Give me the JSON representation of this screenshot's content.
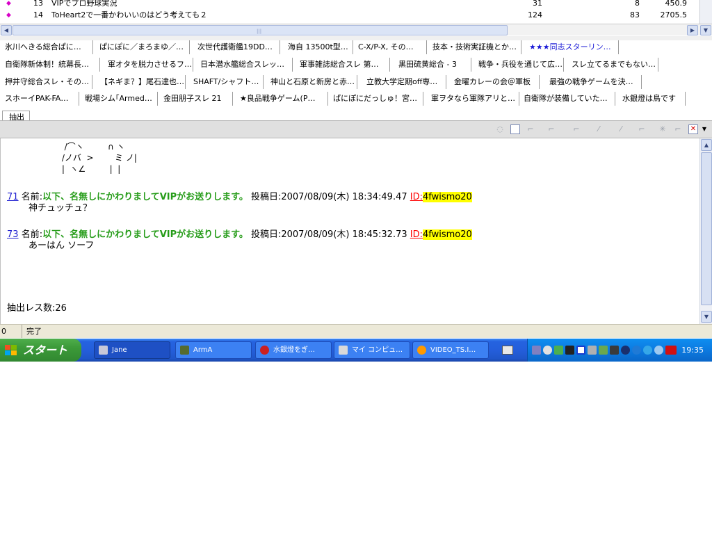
{
  "thread_list": {
    "rows": [
      {
        "mark": "◆",
        "num": "13",
        "title": "VIPでプロ野球実況",
        "res": "31",
        "new": "8",
        "speed": "450.9"
      },
      {
        "mark": "◆",
        "num": "14",
        "title": "ToHeart2で一番かわいいのはどう考えても２",
        "res": "124",
        "new": "83",
        "speed": "2705.5"
      }
    ]
  },
  "tabs": {
    "row1": [
      "氷川へきる総合ぱに…",
      "ぱにぽに／まろまゆ／…",
      "次世代護衛艦19DD…",
      "海自 13500t型…",
      "C-X/P-X, その…",
      "技本・技術実証機とか…",
      "★★★同志スターリン…"
    ],
    "row2": [
      "自衛隊新体制！統幕長…",
      "軍オタを脱力させるフ…",
      "日本潜水艦総合スレッ…",
      "軍事雑誌総合スレ 第…",
      "黒田硫黄総合 - 3",
      "戦争・兵役を通じて広…",
      "スレ立てるまでもない…"
    ],
    "row3": [
      "押井守総合スレ・その…",
      "【ネギま？】尾石達也…",
      "SHAFT/シャフト…",
      "神山と石原と新房と赤…",
      "立教大学定期off専…",
      "金曜カレーの会＠軍板",
      "最強の戦争ゲームを決…"
    ],
    "row4": [
      "スホーイPAK-FA…",
      "戦場シム｢Armed…",
      "金田朋子スレ 21",
      "★良品戦争ゲーム(P…",
      "ぱにぽにだっしゅ！宮…",
      "軍ヲタなら軍隊アリと…",
      "自衛隊が装備していた…",
      "水銀燈は鳥です"
    ],
    "extract": "抽出"
  },
  "viewer": {
    "aa": [
      "  /⌒ヽ         ∩ ヽ",
      " /ノバ  >        ミ ノ|",
      " |  ヽ∠         |  |"
    ],
    "posts": [
      {
        "num": "71",
        "name_label": "名前:",
        "name": "以下、名無しにかわりましてVIPがお送りします。",
        "date_label": "投稿日:",
        "date": "2007/08/09(木) 18:34:49.47",
        "id_label": "ID:",
        "id": "4fwismo20",
        "body": "神チュッチュ？"
      },
      {
        "num": "73",
        "name_label": "名前:",
        "name": "以下、名無しにかわりましてVIPがお送りします。",
        "date_label": "投稿日:",
        "date": "2007/08/09(木) 18:45:32.73",
        "id_label": "ID:",
        "id": "4fwismo20",
        "body": "あーはん ソーフ"
      }
    ],
    "extract_count": "抽出レス数:26"
  },
  "statusbar": {
    "cell0": "0",
    "cell1": "完了"
  },
  "taskbar": {
    "start_label": "スタート",
    "buttons": [
      {
        "label": "Jane",
        "icon_color": "#c8c8d8",
        "active": true
      },
      {
        "label": "ArmA",
        "icon_color": "#556b2f",
        "active": false
      },
      {
        "label": "水銀燈をぎ…",
        "icon_color": "#cc2020",
        "active": false
      },
      {
        "label": "マイ コンピュ…",
        "icon_color": "#d9d9d9",
        "active": false
      },
      {
        "label": "VIDEO_TS.I…",
        "icon_color": "#ff9900",
        "active": false
      }
    ],
    "clock": "19:35"
  }
}
